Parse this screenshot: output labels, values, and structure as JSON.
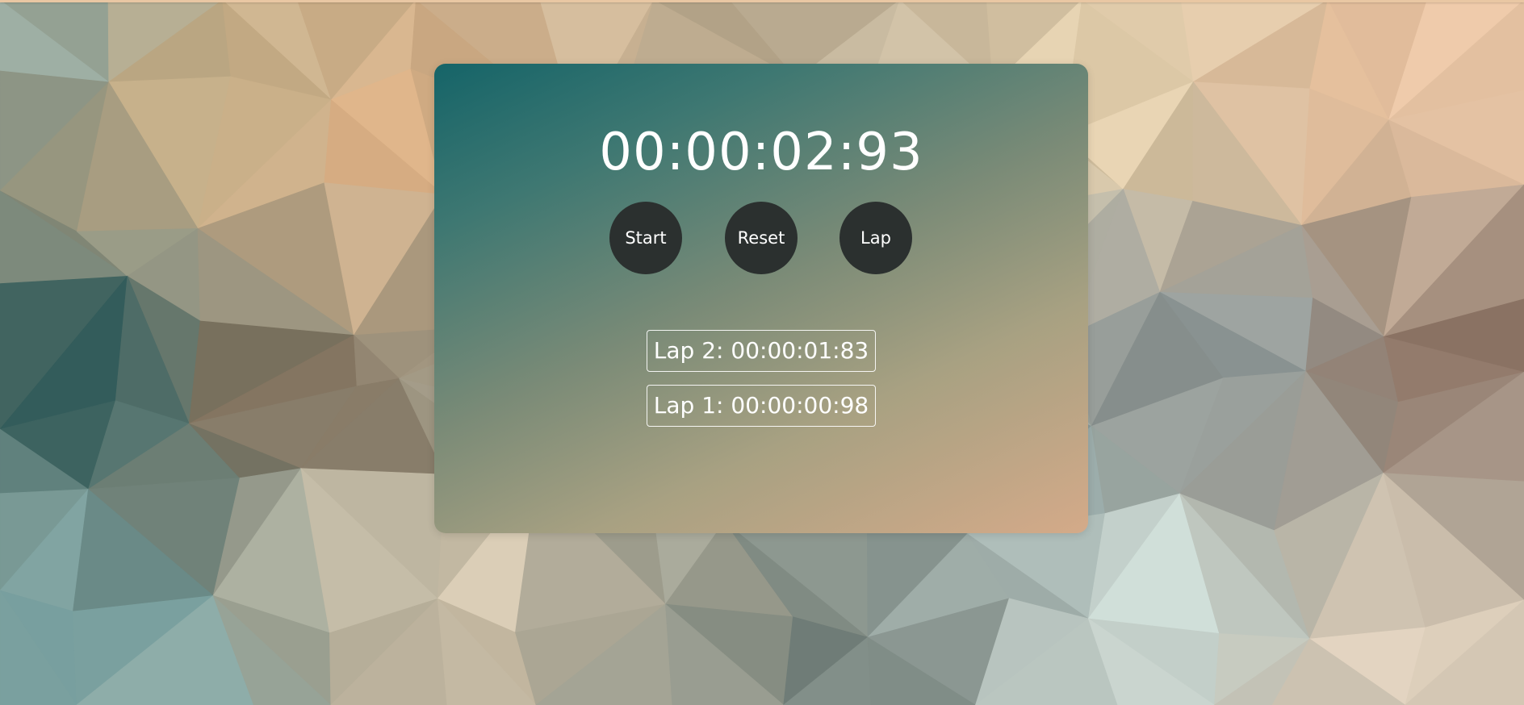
{
  "stopwatch": {
    "time": "00:00:02:93",
    "buttons": {
      "start": "Start",
      "reset": "Reset",
      "lap": "Lap"
    },
    "laps": [
      "Lap 2: 00:00:01:83",
      "Lap 1: 00:00:00:98"
    ]
  },
  "colors": {
    "button_bg": "#2b302f",
    "text": "#ffffff",
    "card_gradient_start": "#156468",
    "card_gradient_end": "#d4aa89"
  }
}
